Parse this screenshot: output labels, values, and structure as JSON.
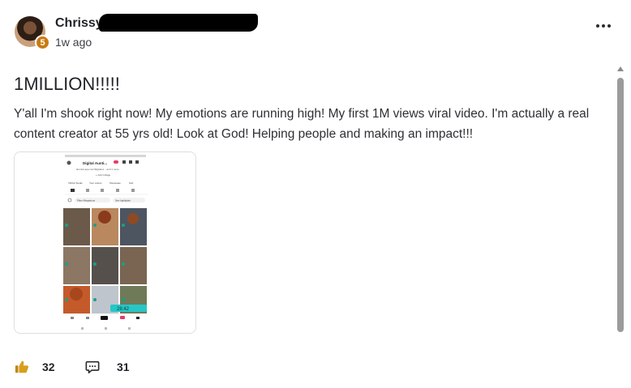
{
  "post": {
    "author_visible": "Chrissy",
    "level": "5",
    "time": "1w ago",
    "title": "1MILLION!!!!!",
    "body": "Y'all I'm shook right now! My emotions are running high! My first 1M views viral video. I'm actually a real content creator at 55 yrs old! Look at God! Helping people and making an impact!!!"
  },
  "attachment": {
    "profile_name": "Digital Aunti...",
    "profile_link": "lamnnk.app.com/Digital-A... and 1 more",
    "add_collage": "+ Add collage",
    "shortcuts": [
      "TikTok Studio",
      "Your orders",
      "Showcase",
      "Sub"
    ],
    "filters": [
      "Filter Allegations",
      "See highlights"
    ],
    "timer": "28:42",
    "nav": [
      "Home",
      "Friends",
      "",
      "Inbox",
      "Profile"
    ]
  },
  "actions": {
    "likes": "32",
    "comments": "31"
  },
  "colors": {
    "badge": "#c97a12",
    "like_icon": "#d89f1c"
  }
}
